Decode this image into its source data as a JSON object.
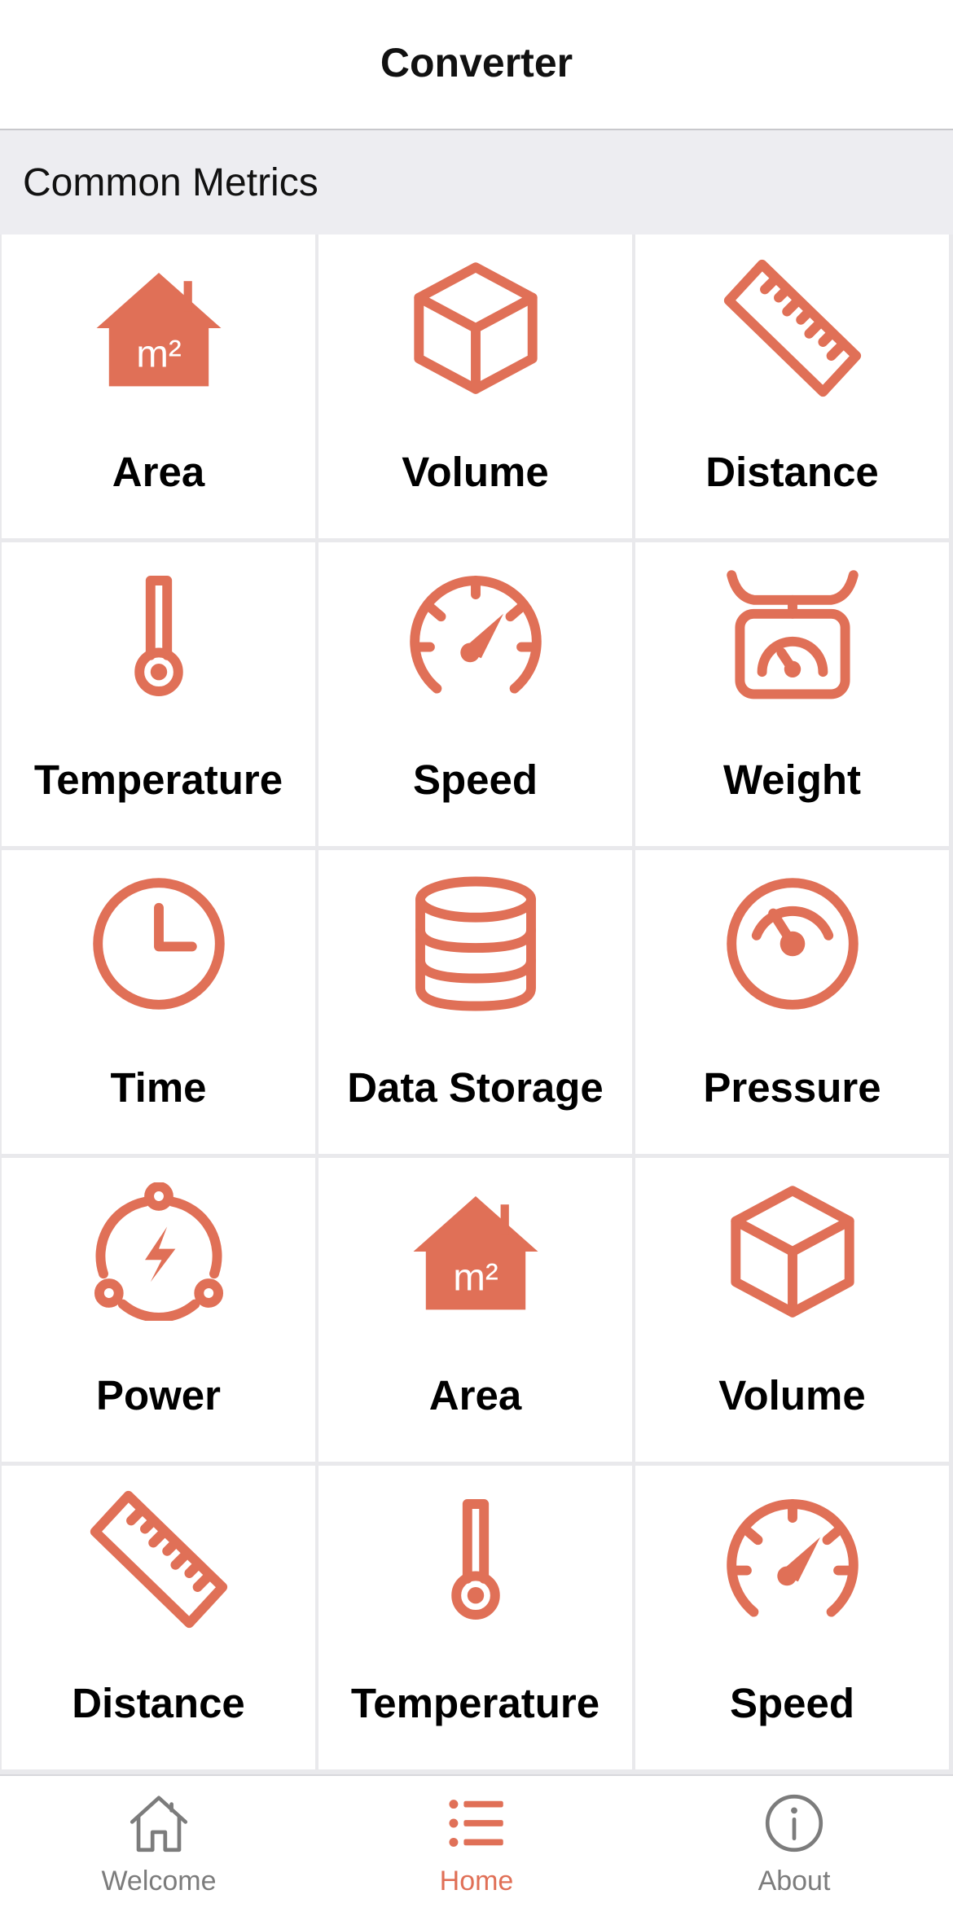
{
  "nav": {
    "title": "Converter"
  },
  "section": {
    "title": "Common Metrics"
  },
  "accent_color": "#e07057",
  "tiles": [
    {
      "label": "Area",
      "icon": "area-icon"
    },
    {
      "label": "Volume",
      "icon": "volume-icon"
    },
    {
      "label": "Distance",
      "icon": "distance-icon"
    },
    {
      "label": "Temperature",
      "icon": "temperature-icon"
    },
    {
      "label": "Speed",
      "icon": "speed-icon"
    },
    {
      "label": "Weight",
      "icon": "weight-icon"
    },
    {
      "label": "Time",
      "icon": "time-icon"
    },
    {
      "label": "Data Storage",
      "icon": "data-storage-icon"
    },
    {
      "label": "Pressure",
      "icon": "pressure-icon"
    },
    {
      "label": "Power",
      "icon": "power-icon"
    },
    {
      "label": "Area",
      "icon": "area-icon"
    },
    {
      "label": "Volume",
      "icon": "volume-icon"
    },
    {
      "label": "Distance",
      "icon": "distance-icon"
    },
    {
      "label": "Temperature",
      "icon": "temperature-icon"
    },
    {
      "label": "Speed",
      "icon": "speed-icon"
    }
  ],
  "area_icon_text": "m²",
  "tabs": [
    {
      "label": "Welcome",
      "icon": "house-icon",
      "active": false
    },
    {
      "label": "Home",
      "icon": "list-icon",
      "active": true
    },
    {
      "label": "About",
      "icon": "info-icon",
      "active": false
    }
  ]
}
